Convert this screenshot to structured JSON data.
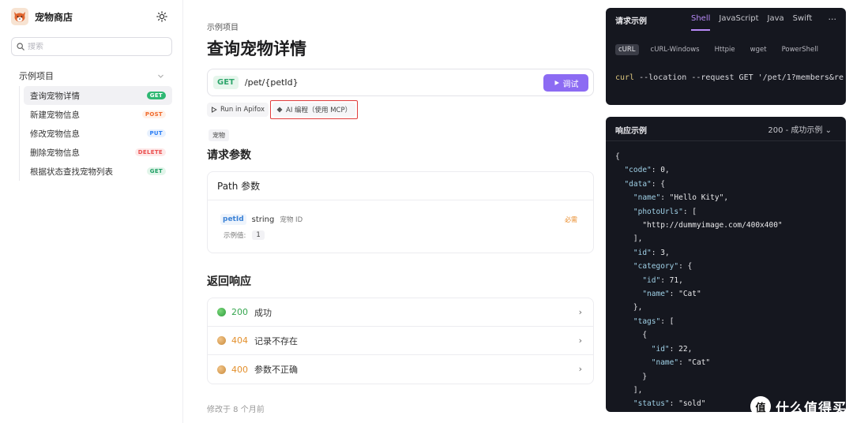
{
  "app": {
    "title": "宠物商店"
  },
  "search": {
    "placeholder": "搜索"
  },
  "sidebar": {
    "group": "示例项目",
    "items": [
      {
        "label": "查询宠物详情",
        "method": "GET"
      },
      {
        "label": "新建宠物信息",
        "method": "POST"
      },
      {
        "label": "修改宠物信息",
        "method": "PUT"
      },
      {
        "label": "删除宠物信息",
        "method": "DELETE"
      },
      {
        "label": "根据状态查找宠物列表",
        "method": "GET"
      }
    ]
  },
  "main": {
    "breadcrumb": "示例项目",
    "title": "查询宠物详情",
    "method": "GET",
    "path": "/pet/{petId}",
    "debug_label": "调试",
    "run_label": "Run in Apifox",
    "mcp_label": "AI 编程（使用 MCP）",
    "tag": "宠物",
    "params_title": "请求参数",
    "path_params_title": "Path 参数",
    "param": {
      "name": "petId",
      "type": "string",
      "desc": "宠物 ID",
      "required": "必需",
      "example_label": "示例值:",
      "example_value": "1"
    },
    "responses_title": "返回响应",
    "responses": [
      {
        "code": "200",
        "text": "成功"
      },
      {
        "code": "404",
        "text": "记录不存在"
      },
      {
        "code": "400",
        "text": "参数不正确"
      }
    ],
    "modified": "修改于 8 个月前"
  },
  "request_panel": {
    "title": "请求示例",
    "tabs": [
      "Shell",
      "JavaScript",
      "Java",
      "Swift"
    ],
    "sub_tabs": [
      "cURL",
      "cURL-Windows",
      "Httpie",
      "wget",
      "PowerShell"
    ],
    "curl_cmd": "curl",
    "curl_rest": " --location --request GET '/pet/1?members&re"
  },
  "response_panel": {
    "title": "响应示例",
    "selector": "200 - 成功示例"
  },
  "colors": {
    "accent": "#8c6bf3",
    "get": "#2fb873",
    "highlight_box": "#e03b3b"
  },
  "watermark": {
    "text": "什么值得买",
    "mark": "值"
  }
}
